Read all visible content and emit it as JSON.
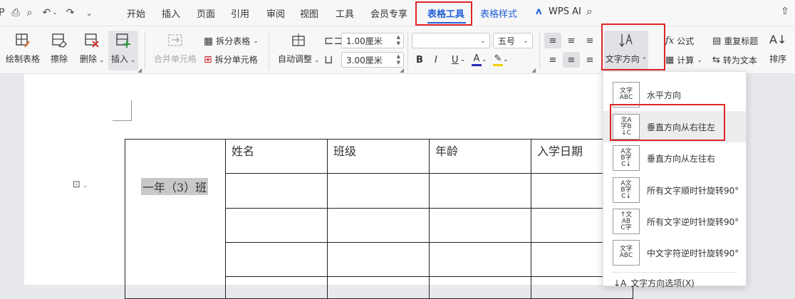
{
  "menubar": {
    "tabs": [
      "开始",
      "插入",
      "页面",
      "引用",
      "审阅",
      "视图",
      "工具",
      "会员专享"
    ],
    "active_tab": "表格工具",
    "table_style_tab": "表格样式",
    "wps_ai": "WPS AI"
  },
  "ribbon": {
    "draw_table": "绘制表格",
    "erase": "擦除",
    "delete": "删除",
    "insert": "插入",
    "merge_cells": "合并单元格",
    "split_table": "拆分表格",
    "split_cells": "拆分单元格",
    "auto_fit": "自动调整",
    "col_width": "1.00厘米",
    "row_height": "3.00厘米",
    "font_name": "",
    "font_size": "五号",
    "text_direction": "文字方向",
    "formula": "公式",
    "repeat_header": "重复标题",
    "calculate": "计算",
    "convert_text": "转为文本",
    "sort": "排序"
  },
  "table": {
    "merged_cell": "一年（3）班",
    "headers": [
      "姓名",
      "班级",
      "年龄",
      "入学日期"
    ]
  },
  "dropdown": {
    "options": [
      {
        "label": "水平方向",
        "icon": "horizontal-text-icon"
      },
      {
        "label": "垂直方向从右往左",
        "icon": "vertical-rtl-icon"
      },
      {
        "label": "垂直方向从左往右",
        "icon": "vertical-ltr-icon"
      },
      {
        "label": "所有文字顺时针旋转90°",
        "icon": "rotate-cw-icon"
      },
      {
        "label": "所有文字逆时针旋转90°",
        "icon": "rotate-ccw-icon"
      },
      {
        "label": "中文字符逆时针旋转90°",
        "icon": "cjk-rotate-ccw-icon"
      }
    ],
    "more": "文字方向选项(X)"
  }
}
